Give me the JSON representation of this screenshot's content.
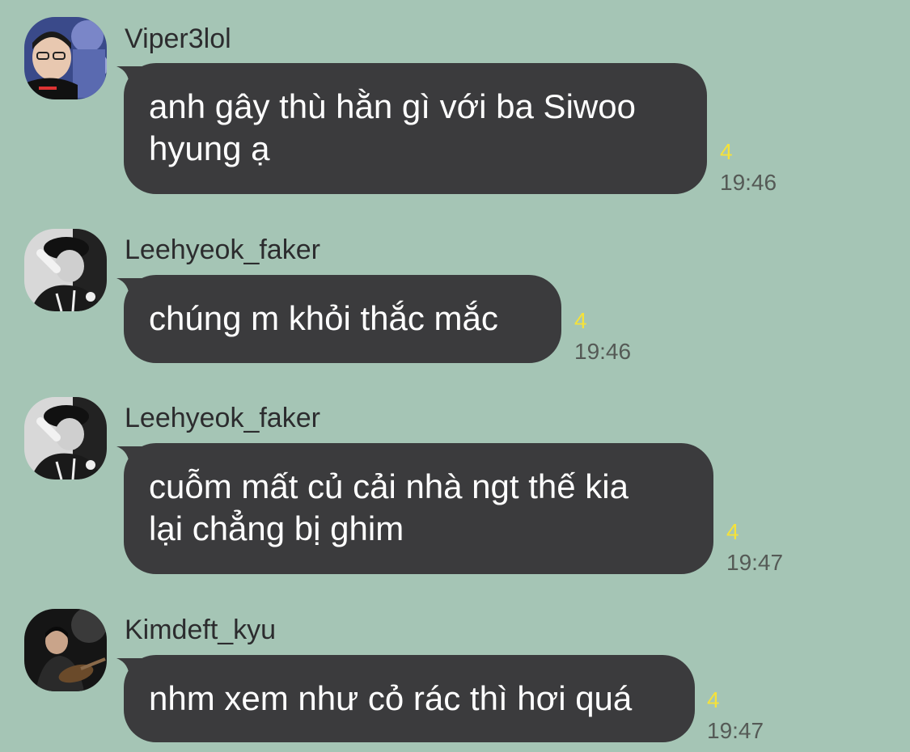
{
  "messages": [
    {
      "sender": "Viper3lol",
      "avatar_icon": "user-avatar-photo",
      "text": "anh gây thù hằn gì với ba Siwoo\nhyung ạ",
      "unread_count": "4",
      "time": "19:46"
    },
    {
      "sender": "Leehyeok_faker",
      "avatar_icon": "user-avatar-photo-bw",
      "text": "chúng m khỏi thắc mắc",
      "unread_count": "4",
      "time": "19:46"
    },
    {
      "sender": "Leehyeok_faker",
      "avatar_icon": "user-avatar-photo-bw",
      "text": "cuỗm mất củ cải nhà ngt thế kia\nlại chẳng bị ghim",
      "unread_count": "4",
      "time": "19:47"
    },
    {
      "sender": "Kimdeft_kyu",
      "avatar_icon": "user-avatar-photo-dark",
      "text": "nhm xem như cỏ rác thì hơi quá",
      "unread_count": "4",
      "time": "19:47"
    }
  ],
  "colors": {
    "background": "#a5c5b5",
    "bubble": "#3b3b3d",
    "bubble_text": "#ffffff",
    "unread_count": "#f5e23a",
    "time": "#555a56",
    "sender": "#2c2c2e"
  }
}
